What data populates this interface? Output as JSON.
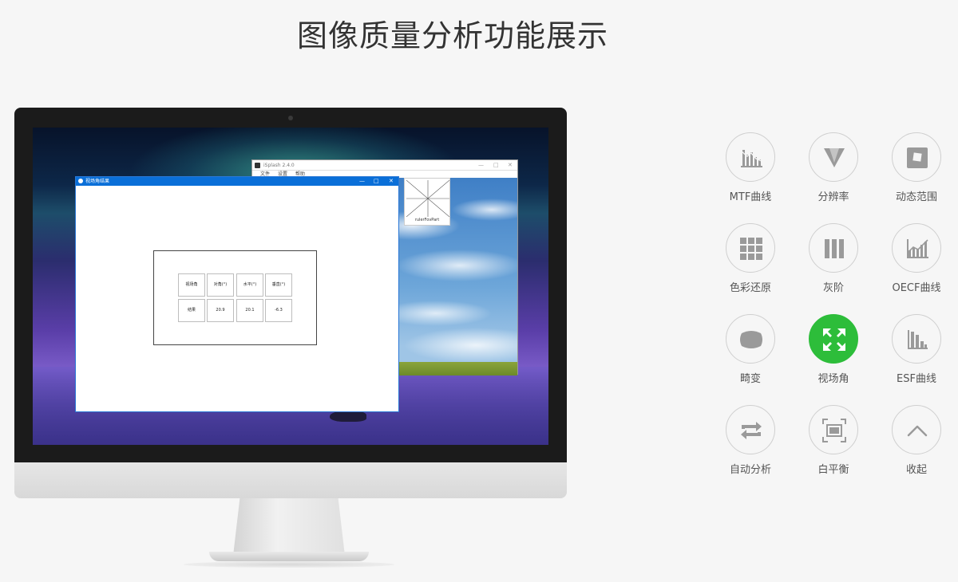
{
  "page": {
    "title": "图像质量分析功能展示"
  },
  "background_window": {
    "title": "iSplash 2.4.0",
    "menu": [
      "文件",
      "设置",
      "帮助"
    ],
    "controls": [
      "—",
      "□",
      "✕"
    ],
    "thumbnail_label": "rulerFovPart"
  },
  "dialog": {
    "title": "视场角结果",
    "controls": [
      "—",
      "□",
      "✕"
    ],
    "table": {
      "headers": [
        "视场角",
        "对角(°)",
        "水平(°)",
        "垂直(°)"
      ],
      "row": [
        "结果",
        "20.9",
        "20.1",
        "-6.3"
      ]
    }
  },
  "functions": [
    {
      "label": "MTF曲线",
      "icon": "mtf-chart-icon"
    },
    {
      "label": "分辨率",
      "icon": "resolution-icon"
    },
    {
      "label": "动态范围",
      "icon": "dynamic-range-icon"
    },
    {
      "label": "色彩还原",
      "icon": "color-grid-icon"
    },
    {
      "label": "灰阶",
      "icon": "grayscale-bars-icon"
    },
    {
      "label": "OECF曲线",
      "icon": "oecf-chart-icon"
    },
    {
      "label": "畸变",
      "icon": "distortion-icon"
    },
    {
      "label": "视场角",
      "icon": "fov-expand-icon",
      "active": true
    },
    {
      "label": "ESF曲线",
      "icon": "esf-chart-icon"
    },
    {
      "label": "自动分析",
      "icon": "auto-repeat-icon"
    },
    {
      "label": "白平衡",
      "icon": "white-balance-icon"
    },
    {
      "label": "收起",
      "icon": "chevron-up-icon"
    }
  ],
  "colors": {
    "accent_green": "#2dbd3a",
    "icon_gray": "#9a9a9a",
    "dialog_blue": "#0a6fd8"
  }
}
